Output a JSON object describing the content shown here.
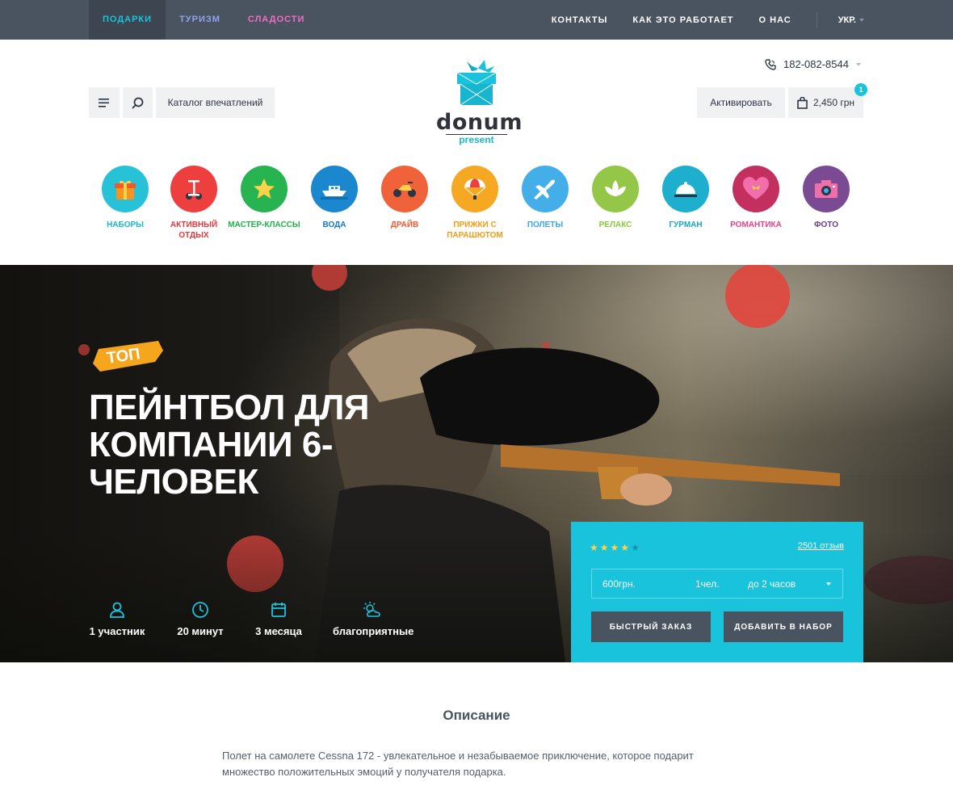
{
  "topbar": {
    "left_nav": [
      {
        "label": "ПОДАРКИ",
        "color": "#19c3dc",
        "active": true
      },
      {
        "label": "ТУРИЗМ",
        "color": "#8fa2f0"
      },
      {
        "label": "СЛАДОСТИ",
        "color": "#f06ec8"
      }
    ],
    "right_nav": [
      {
        "label": "КОНТАКТЫ"
      },
      {
        "label": "КАК ЭТО РАБОТАЕТ"
      },
      {
        "label": "О НАС"
      }
    ],
    "language": "УКР."
  },
  "header": {
    "phone": "182-082-8544",
    "catalog_label": "Каталог впечатлений",
    "activate_label": "Активировать",
    "cart_total": "2,450 грн",
    "cart_count": "1",
    "logo_word": "donum",
    "logo_sub": "present"
  },
  "categories": [
    {
      "label": "НАБОРЫ",
      "color": "#19b7cc",
      "bg": "#27c2d8",
      "icon": "gift-icon"
    },
    {
      "label": "АКТИВНЫЙ ОТДЫХ",
      "color": "#e8373d",
      "bg": "#ee3f3f",
      "icon": "segway-icon"
    },
    {
      "label": "МАСТЕР-КЛАССЫ",
      "color": "#1fb24a",
      "bg": "#27b34f",
      "icon": "star-icon"
    },
    {
      "label": "ВОДА",
      "color": "#1679c4",
      "bg": "#1b87cf",
      "icon": "boat-icon"
    },
    {
      "label": "ДРАЙВ",
      "color": "#ee5a32",
      "bg": "#f0623a",
      "icon": "motorbike-icon"
    },
    {
      "label": "ПРИЖКИ С ПАРАШЮТОМ",
      "color": "#f49b17",
      "bg": "#f7a823",
      "icon": "parachute-icon"
    },
    {
      "label": "ПОЛЕТЫ",
      "color": "#3aa6e6",
      "bg": "#44aee8",
      "icon": "plane-icon"
    },
    {
      "label": "РЕЛАКС",
      "color": "#8cc63f",
      "bg": "#94c748",
      "icon": "lotus-icon"
    },
    {
      "label": "ГУРМАН",
      "color": "#16a7c7",
      "bg": "#1dafcd",
      "icon": "cloche-icon"
    },
    {
      "label": "РОМАНТИКА",
      "color": "#e5428a",
      "bg": "#c3305f",
      "icon": "heart-icon"
    },
    {
      "label": "ФОТО",
      "color": "#6c3c86",
      "bg": "#7a4a92",
      "icon": "camera-icon"
    }
  ],
  "hero": {
    "badge": "ТОП",
    "title": "ПЕЙНТБОЛ ДЛЯ КОМПАНИИ 6-ЧЕЛОВЕК",
    "features": [
      {
        "label": "1 участник",
        "icon": "person-icon"
      },
      {
        "label": "20 минут",
        "icon": "clock-icon"
      },
      {
        "label": "3 месяца",
        "icon": "calendar-icon"
      },
      {
        "label": "благоприятные",
        "icon": "weather-icon"
      }
    ]
  },
  "order": {
    "rating": 4,
    "rating_max": 5,
    "reviews": "2501 отзыв",
    "price": "600грн.",
    "people": "1чел.",
    "duration": "до 2 часов",
    "quick_order": "БЫСТРЫЙ ЗАКАЗ",
    "add_to_set": "ДОБАВИТЬ В НАБОР"
  },
  "description": {
    "title": "Описание",
    "text": "Полет на самолете Cessna 172 - увлекательное и незабываемое приключение, которое подарит множество положительных эмоций у получателя подарка."
  }
}
